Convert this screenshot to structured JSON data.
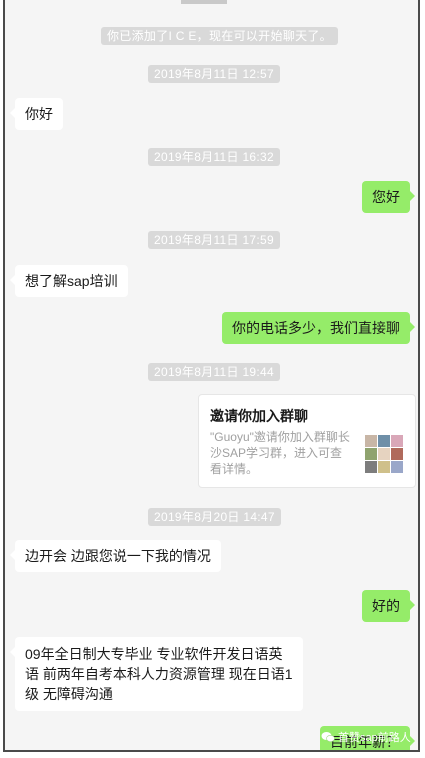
{
  "notice": "你已添加了I C E，现在可以开始聊天了。",
  "messages": [
    {
      "time": "2019年8月11日 12:57",
      "side": "left",
      "text": "你好"
    },
    {
      "time": "2019年8月11日 16:32",
      "side": "right",
      "text": "您好"
    },
    {
      "time": "2019年8月11日 17:59",
      "side": "left",
      "text": "想了解sap培训"
    },
    {
      "side": "right",
      "text": "你的电话多少，我们直接聊"
    },
    {
      "time": "2019年8月11日 19:44"
    },
    {
      "time": "2019年8月20日 14:47",
      "side": "left",
      "text": "边开会   边跟您说一下我的情况"
    },
    {
      "side": "right",
      "text": "好的"
    },
    {
      "side": "left",
      "text": "09年全日制大专毕业  专业软件开发日语英语    前两年自考本科人力资源管理    现在日语1级   无障碍沟通"
    },
    {
      "side": "right",
      "text": "目前年薪？"
    }
  ],
  "invite_card": {
    "title": "邀请你加入群聊",
    "desc": "\"Guoyu\"邀请你加入群聊长沙SAP学习群，进入可查看详情。"
  },
  "watermark": "首赞sap前路人",
  "colors": {
    "bg": "#f5f5f5",
    "right_bubble": "#95ec69",
    "left_bubble": "#ffffff",
    "pill": "#d9d9d9"
  }
}
